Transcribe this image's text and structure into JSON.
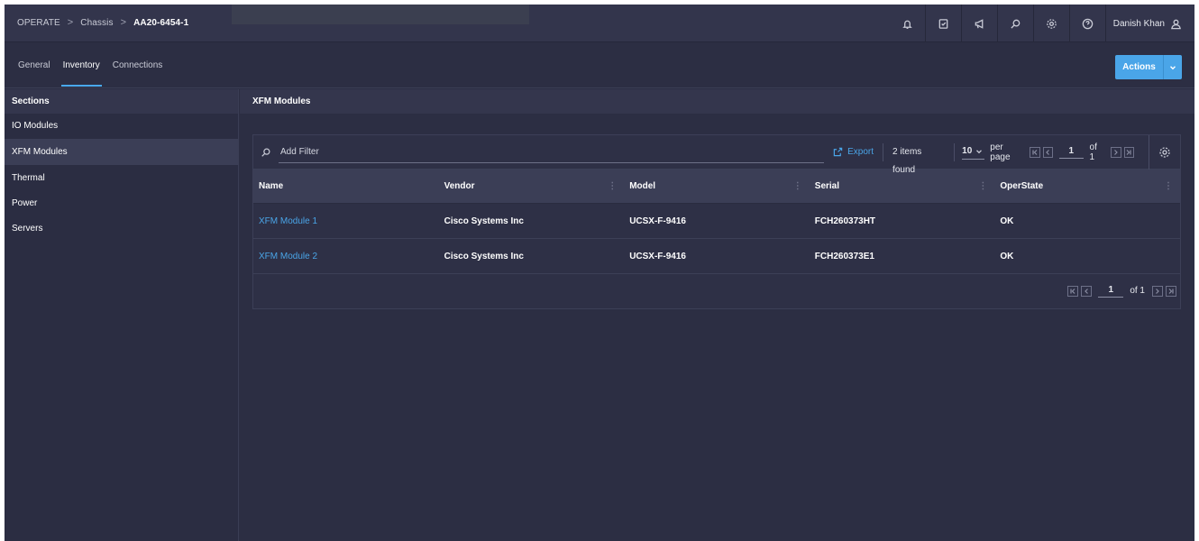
{
  "header": {
    "breadcrumb": {
      "root": "OPERATE",
      "sep": ">",
      "section": "Chassis",
      "current": "AA20-6454-1"
    },
    "icons": [
      "bell-icon",
      "task-icon",
      "megaphone-icon",
      "search-icon",
      "gear-icon",
      "help-icon"
    ],
    "user_name": "Danish Khan"
  },
  "tabs": [
    {
      "label": "General",
      "active": false
    },
    {
      "label": "Inventory",
      "active": true
    },
    {
      "label": "Connections",
      "active": false
    }
  ],
  "actions_label": "Actions",
  "sidebar": {
    "title": "Sections",
    "items": [
      {
        "label": "IO Modules"
      },
      {
        "label": "XFM Modules"
      },
      {
        "label": "Thermal"
      },
      {
        "label": "Power"
      },
      {
        "label": "Servers"
      }
    ]
  },
  "main": {
    "title": "XFM Modules",
    "filter_placeholder": "Add Filter",
    "export_label": "Export",
    "items_found": "2 items found",
    "per_page_value": "10",
    "per_page_label": "per page",
    "page": "1",
    "of_pages": "of 1",
    "columns": [
      "Name",
      "Vendor",
      "Model",
      "Serial",
      "OperState"
    ],
    "rows": [
      {
        "name": "XFM Module 1",
        "vendor": "Cisco Systems Inc",
        "model": "UCSX-F-9416",
        "serial": "FCH260373HT",
        "state": "OK"
      },
      {
        "name": "XFM Module 2",
        "vendor": "Cisco Systems Inc",
        "model": "UCSX-F-9416",
        "serial": "FCH260373E1",
        "state": "OK"
      }
    ]
  },
  "colors": {
    "accent": "#4aa5e8",
    "background": "#2c2e43",
    "header": "#33354c",
    "row_header": "#3b3e56"
  }
}
